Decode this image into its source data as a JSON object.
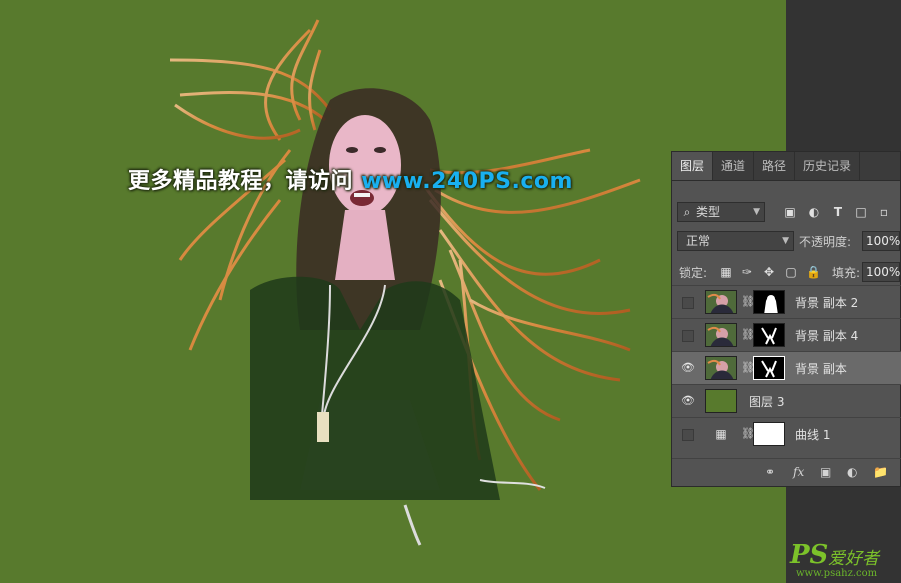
{
  "watermark": {
    "text": "更多精品教程，请访问",
    "url": "www.240PS.com"
  },
  "corner_logo": {
    "ps": "PS",
    "cn": "爱好者",
    "site": "www.psahz.com"
  },
  "panel": {
    "tabs": [
      "图层",
      "通道",
      "路径",
      "历史记录"
    ],
    "active_tab": "图层",
    "filter": {
      "value": "类型"
    },
    "blend_mode": "正常",
    "opacity_label": "不透明度:",
    "opacity_value": "100%",
    "lock_label": "锁定:",
    "fill_label": "填充:",
    "fill_value": "100%",
    "layers": [
      {
        "name": "背景 副本 2",
        "visible": false,
        "selected": false
      },
      {
        "name": "背景 副本 4",
        "visible": false,
        "selected": false
      },
      {
        "name": "背景 副本",
        "visible": true,
        "selected": true
      },
      {
        "name": "图层 3",
        "visible": true,
        "selected": false
      },
      {
        "name": "曲线 1",
        "visible": false,
        "selected": false
      }
    ],
    "colors": {
      "layer3_fill": "#587a2d",
      "canvas_bg": "#587a2d",
      "selected_row": "#6a6a6a"
    }
  }
}
